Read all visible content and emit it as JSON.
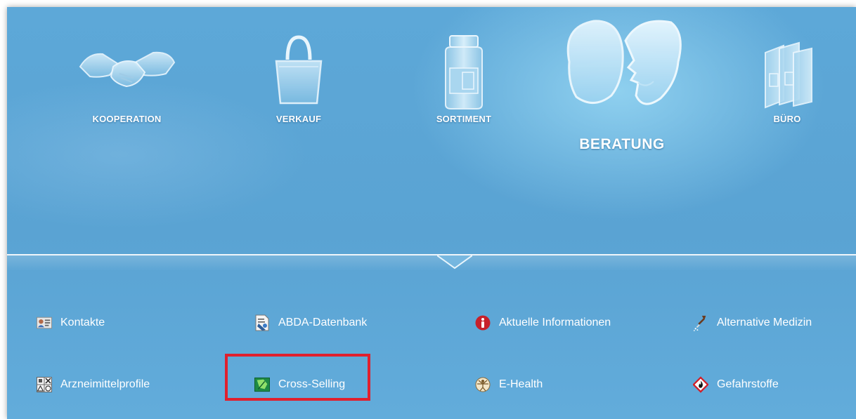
{
  "nav": {
    "items": [
      {
        "label": "KOOPERATION",
        "icon": "handshake-icon"
      },
      {
        "label": "VERKAUF",
        "icon": "shopping-bag-icon"
      },
      {
        "label": "SORTIMENT",
        "icon": "medicine-jar-icon"
      },
      {
        "label": "BERATUNG",
        "icon": "consultation-faces-icon",
        "active": true
      },
      {
        "label": "BÜRO",
        "icon": "binders-icon"
      }
    ]
  },
  "menu": {
    "items": [
      {
        "label": "Kontakte",
        "icon": "contact-card-icon"
      },
      {
        "label": "ABDA-Datenbank",
        "icon": "database-document-icon"
      },
      {
        "label": "Aktuelle Informationen",
        "icon": "info-icon"
      },
      {
        "label": "Alternative Medizin",
        "icon": "dropper-icon"
      },
      {
        "label": "Arzneimittelprofile",
        "icon": "hazard-symbols-icon"
      },
      {
        "label": "Cross-Selling",
        "icon": "cross-selling-icon",
        "highlighted": true
      },
      {
        "label": "E-Health",
        "icon": "vitruvian-man-icon"
      },
      {
        "label": "Gefahrstoffe",
        "icon": "flammable-hazard-icon"
      }
    ]
  },
  "colors": {
    "background": "#5ca6d6",
    "highlight": "#e0202e",
    "text": "#ffffff",
    "info_red": "#c7212b"
  }
}
